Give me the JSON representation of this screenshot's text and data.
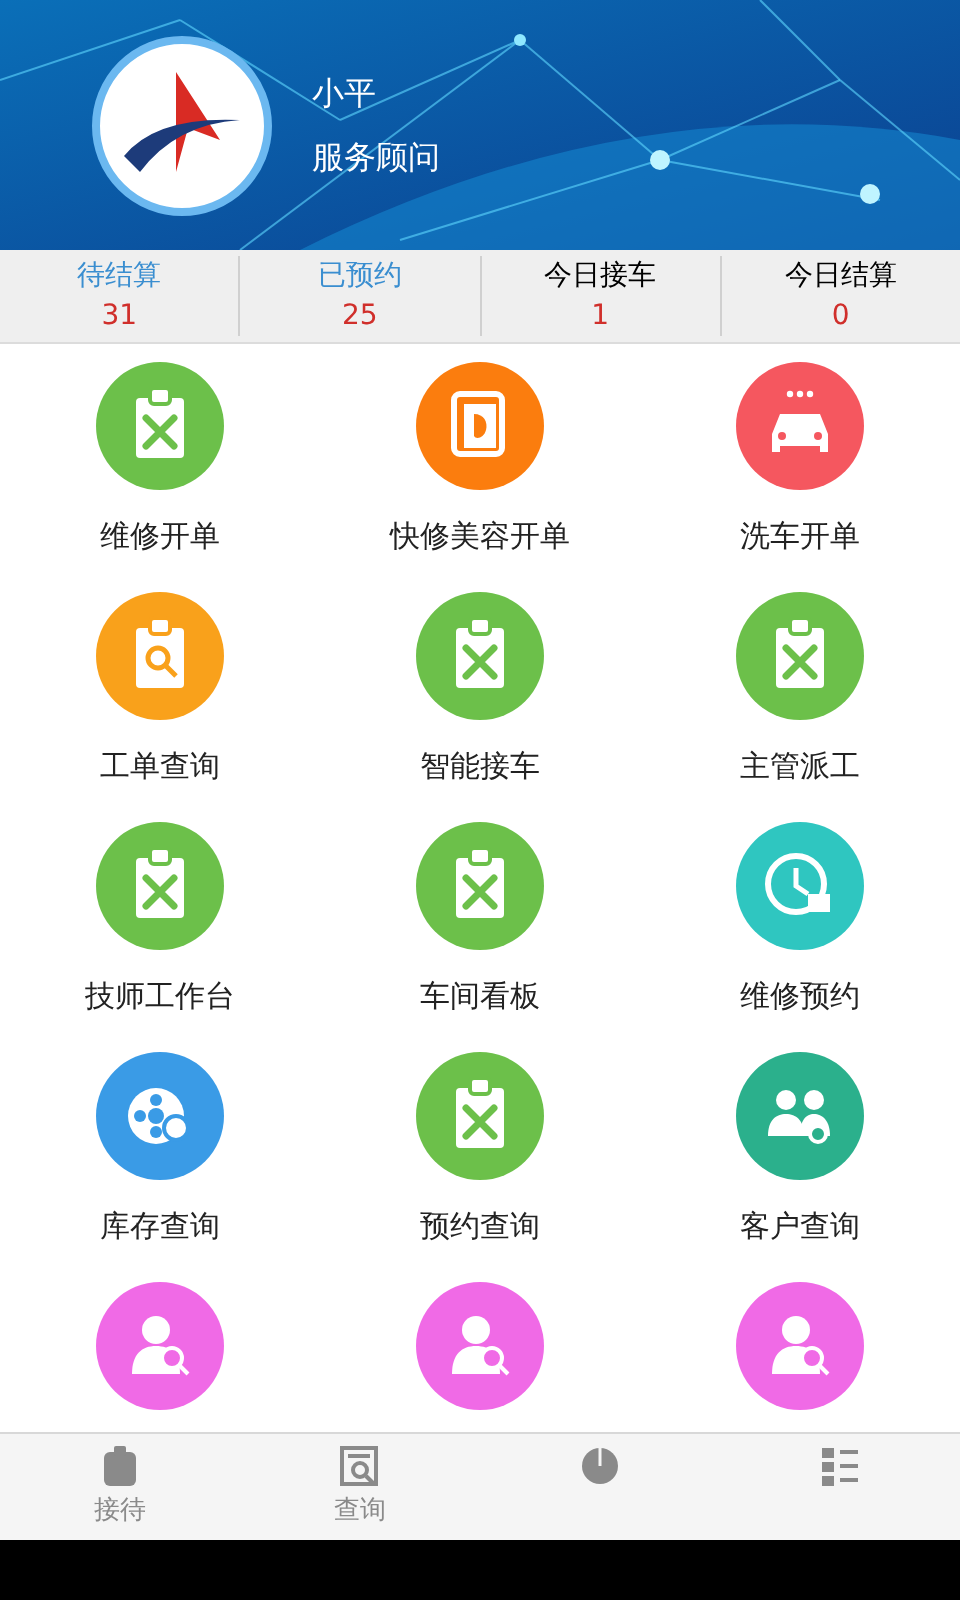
{
  "profile": {
    "name": "小平",
    "role": "服务顾问"
  },
  "stats": [
    {
      "label": "待结算",
      "value": "31",
      "highlighted": true
    },
    {
      "label": "已预约",
      "value": "25",
      "highlighted": true
    },
    {
      "label": "今日接车",
      "value": "1",
      "highlighted": false
    },
    {
      "label": "今日结算",
      "value": "0",
      "highlighted": false
    }
  ],
  "menu": [
    {
      "label": "维修开单",
      "kind": "repair",
      "color": "#6cc04a"
    },
    {
      "label": "快修美容开单",
      "kind": "beauty",
      "color": "#fb7d0e"
    },
    {
      "label": "洗车开单",
      "kind": "carwash",
      "color": "#f5575f"
    },
    {
      "label": "工单查询",
      "kind": "order-search",
      "color": "#f9a11b"
    },
    {
      "label": "智能接车",
      "kind": "repair",
      "color": "#6cc04a"
    },
    {
      "label": "主管派工",
      "kind": "repair",
      "color": "#6cc04a"
    },
    {
      "label": "技师工作台",
      "kind": "repair",
      "color": "#6cc04a"
    },
    {
      "label": "车间看板",
      "kind": "repair",
      "color": "#6cc04a"
    },
    {
      "label": "维修预约",
      "kind": "clock",
      "color": "#2fc6c0"
    },
    {
      "label": "库存查询",
      "kind": "stock",
      "color": "#3a9be6"
    },
    {
      "label": "预约查询",
      "kind": "repair",
      "color": "#6cc04a"
    },
    {
      "label": "客户查询",
      "kind": "people",
      "color": "#2bb08c"
    },
    {
      "kind": "person",
      "color": "#f06ae6"
    },
    {
      "kind": "person",
      "color": "#f06ae6"
    },
    {
      "kind": "person",
      "color": "#f06ae6"
    }
  ],
  "bottom_nav": [
    {
      "label": "接待",
      "kind": "clipboard"
    },
    {
      "label": "查询",
      "kind": "search-doc"
    },
    {
      "kind": "chart"
    },
    {
      "kind": "list"
    }
  ]
}
